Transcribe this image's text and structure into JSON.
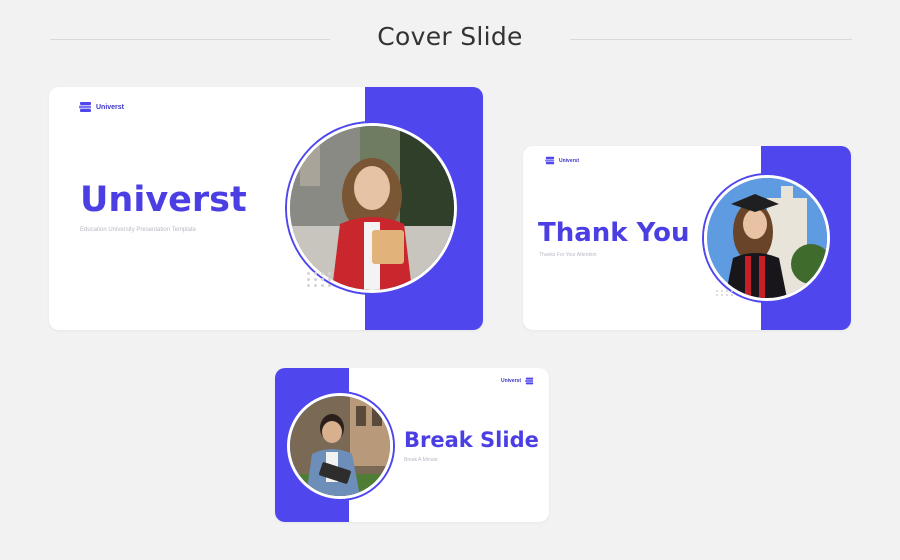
{
  "page": {
    "title": "Cover Slide"
  },
  "slides": {
    "cover": {
      "brand": "Universt",
      "title": "Universt",
      "subtitle": "Education University Presentation Template"
    },
    "thanks": {
      "brand": "Universt",
      "title": "Thank You",
      "subtitle": "Thanks For Your Attention"
    },
    "break": {
      "brand": "Universt",
      "title": "Break Slide",
      "subtitle": "Break A Minute"
    }
  },
  "colors": {
    "accent": "#4f46ee",
    "title": "#4b3fe4",
    "background": "#f2f2f2"
  },
  "icons": {
    "logo": "book-stack-icon"
  }
}
